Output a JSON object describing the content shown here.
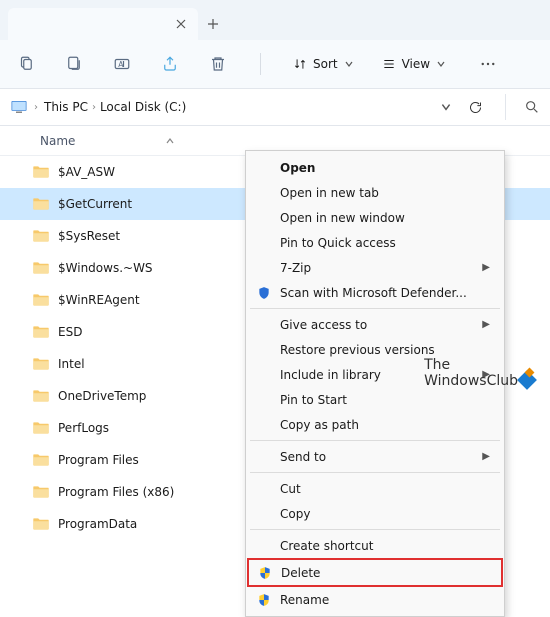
{
  "tabbar": {
    "close_tooltip": "Close",
    "newtab_tooltip": "New tab"
  },
  "toolbar": {
    "sort_label": "Sort",
    "view_label": "View"
  },
  "breadcrumbs": {
    "items": [
      "This PC",
      "Local Disk (C:)"
    ]
  },
  "column_header": {
    "name": "Name"
  },
  "folders": [
    {
      "name": "$AV_ASW"
    },
    {
      "name": "$GetCurrent"
    },
    {
      "name": "$SysReset"
    },
    {
      "name": "$Windows.~WS"
    },
    {
      "name": "$WinREAgent"
    },
    {
      "name": "ESD"
    },
    {
      "name": "Intel"
    },
    {
      "name": "OneDriveTemp"
    },
    {
      "name": "PerfLogs"
    },
    {
      "name": "Program Files"
    },
    {
      "name": "Program Files (x86)"
    },
    {
      "name": "ProgramData"
    }
  ],
  "selected_index": 1,
  "context_menu": {
    "open": "Open",
    "open_new_tab": "Open in new tab",
    "open_new_window": "Open in new window",
    "pin_quick": "Pin to Quick access",
    "sevenzip": "7-Zip",
    "scan_defender": "Scan with Microsoft Defender...",
    "give_access": "Give access to",
    "restore_prev": "Restore previous versions",
    "include_lib": "Include in library",
    "pin_start": "Pin to Start",
    "copy_path": "Copy as path",
    "send_to": "Send to",
    "cut": "Cut",
    "copy": "Copy",
    "create_shortcut": "Create shortcut",
    "delete": "Delete",
    "rename": "Rename"
  },
  "watermark": {
    "line1": "The",
    "line2": "WindowsClub"
  }
}
